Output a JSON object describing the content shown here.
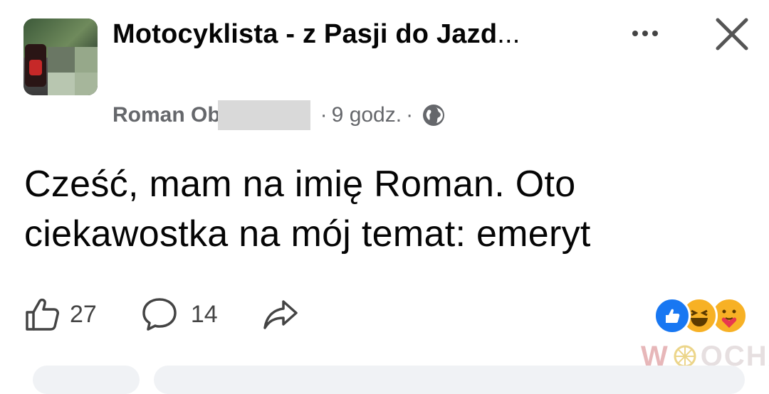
{
  "post": {
    "group_name": "Motocyklista - z Pasji do Jazd",
    "group_name_ellipsis": "...",
    "author": "Roman Ob",
    "time": "9 godz.",
    "separator": "·",
    "text": "Cześć, mam na imię Roman. Oto ciekawostka na mój temat: emeryt"
  },
  "stats": {
    "likes": "27",
    "comments": "14"
  },
  "icons": {
    "audience": "globe-icon",
    "like": "thumbs-up-icon",
    "comment": "comment-bubble-icon",
    "share": "share-arrow-icon",
    "more": "more-dots-icon",
    "close": "close-icon"
  },
  "reactions": [
    "like",
    "haha",
    "care"
  ],
  "watermark": {
    "mark": "W",
    "text": "OCHA"
  },
  "colors": {
    "like_blue": "#1877f2",
    "reaction_yellow": "#f7b125",
    "meta_gray": "#65676b"
  }
}
